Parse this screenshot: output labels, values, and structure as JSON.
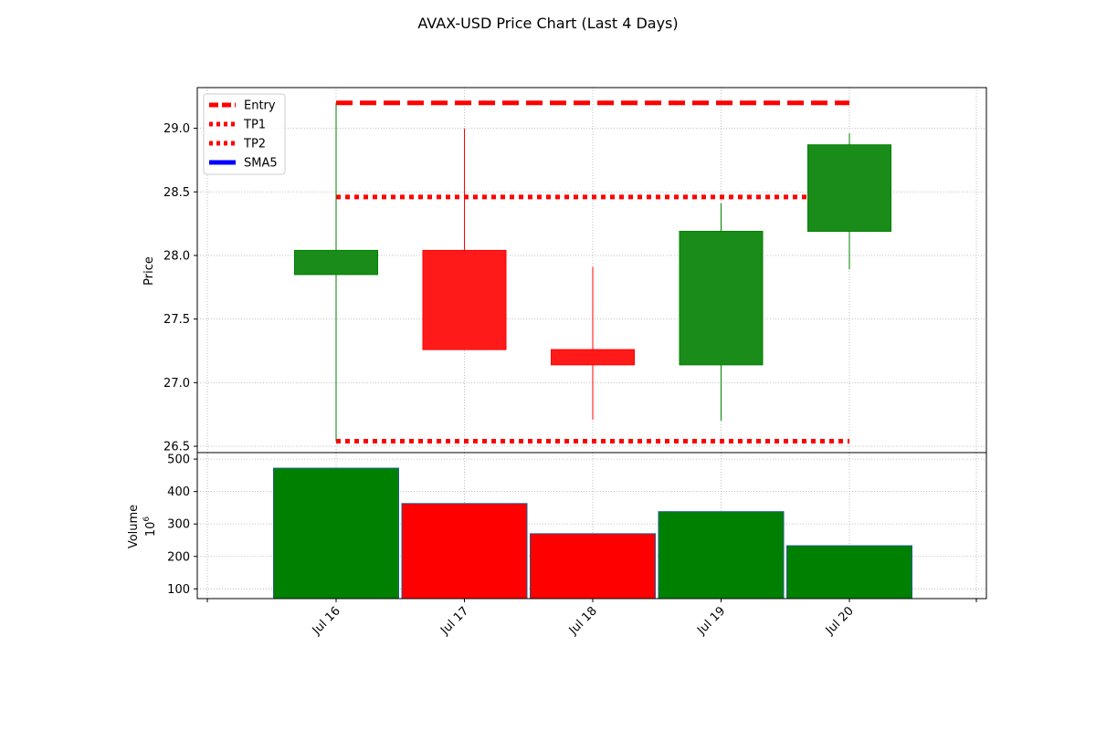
{
  "chart_data": {
    "type": "candlestick",
    "title": "AVAX-USD Price Chart (Last 4 Days)",
    "categories": [
      "Jul 16",
      "Jul 17",
      "Jul 18",
      "Jul 19",
      "Jul 20"
    ],
    "price_panel": {
      "ylabel": "Price",
      "ylim": [
        26.45,
        29.32
      ],
      "yticks": [
        "26.5",
        "27.0",
        "27.5",
        "28.0",
        "28.5",
        "29.0"
      ],
      "grid": true,
      "candles": [
        {
          "date": "Jul 16",
          "open": 27.85,
          "high": 29.2,
          "low": 26.54,
          "close": 28.04
        },
        {
          "date": "Jul 17",
          "open": 28.04,
          "high": 29.0,
          "low": 27.27,
          "close": 27.26
        },
        {
          "date": "Jul 18",
          "open": 27.26,
          "high": 27.91,
          "low": 26.71,
          "close": 27.14
        },
        {
          "date": "Jul 19",
          "open": 27.14,
          "high": 28.41,
          "low": 26.7,
          "close": 28.19
        },
        {
          "date": "Jul 20",
          "open": 28.19,
          "high": 28.96,
          "low": 27.89,
          "close": 28.87
        }
      ],
      "levels": [
        {
          "name": "Entry",
          "value": 29.2,
          "style": "dashed",
          "color": "#ff0000"
        },
        {
          "name": "TP1",
          "value": 28.46,
          "style": "dotted",
          "color": "#ff0000"
        },
        {
          "name": "TP2",
          "value": 26.54,
          "style": "dotted",
          "color": "#ff0000"
        }
      ],
      "legend": {
        "position": "top-left",
        "entries": [
          {
            "label": "Entry",
            "style": "dashed",
            "color": "#ff0000"
          },
          {
            "label": "TP1",
            "style": "dotted",
            "color": "#ff0000"
          },
          {
            "label": "TP2",
            "style": "dotted",
            "color": "#ff0000"
          },
          {
            "label": "SMA5",
            "style": "solid",
            "color": "#0000ff"
          }
        ]
      }
    },
    "volume_panel": {
      "ylabel": "Volume",
      "scale_label": "10",
      "scale_exp": "6",
      "ylim": [
        70,
        520
      ],
      "yticks": [
        "100",
        "200",
        "300",
        "400",
        "500"
      ],
      "grid": true,
      "values": [
        472,
        363,
        270,
        338,
        233
      ],
      "colors": [
        "#008000",
        "#ff0000",
        "#ff0000",
        "#008000",
        "#008000"
      ]
    },
    "colors": {
      "up": "#008000",
      "down": "#ff0000",
      "up_body": "#1a8c1a",
      "down_body": "#ff1a1a",
      "grid": "#b0b0b0"
    }
  }
}
